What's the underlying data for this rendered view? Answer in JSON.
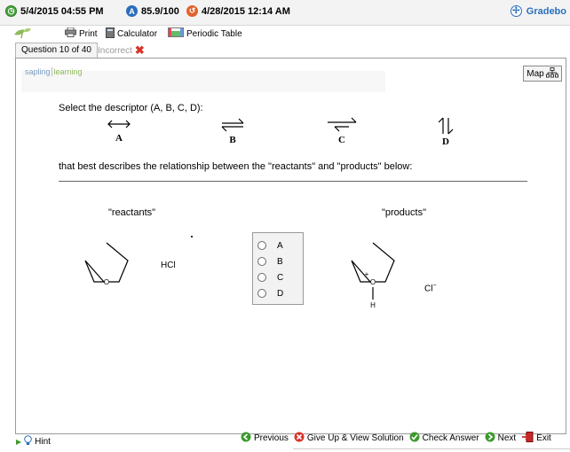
{
  "status_bar": {
    "date_due": "5/4/2015 04:55 PM",
    "score": "85.9/100",
    "date_submitted": "4/28/2015 12:14 AM",
    "gradebook": "Gradebo"
  },
  "toolbar": {
    "print": "Print",
    "calculator": "Calculator",
    "periodic_table": "Periodic Table"
  },
  "question": {
    "tab": "Question 10 of 40",
    "status": "Incorrect"
  },
  "panel": {
    "map": "Map",
    "logo_sapling": "sapling",
    "logo_learning": "learning",
    "prompt": "Select the descriptor (A, B, C, D):",
    "relation": "that best describes the relationship between the \"reactants\" and \"products\" below:",
    "descriptors": [
      "A",
      "B",
      "C",
      "D"
    ],
    "reactants_label": "\"reactants\"",
    "products_label": "\"products\"",
    "hcl": "HCl",
    "chloride": "Cl",
    "chloride_charge": "−",
    "oxygen": "O",
    "hydrogen": "H",
    "plus": "+",
    "choices": [
      "A",
      "B",
      "C",
      "D"
    ]
  },
  "actions": {
    "previous": "Previous",
    "give_up": "Give Up & View Solution",
    "check": "Check Answer",
    "next": "Next",
    "exit": "Exit"
  },
  "hint": "Hint",
  "colors": {
    "link_blue": "#2a6ebb",
    "green": "#3d9a2f",
    "red": "#d9332a"
  }
}
